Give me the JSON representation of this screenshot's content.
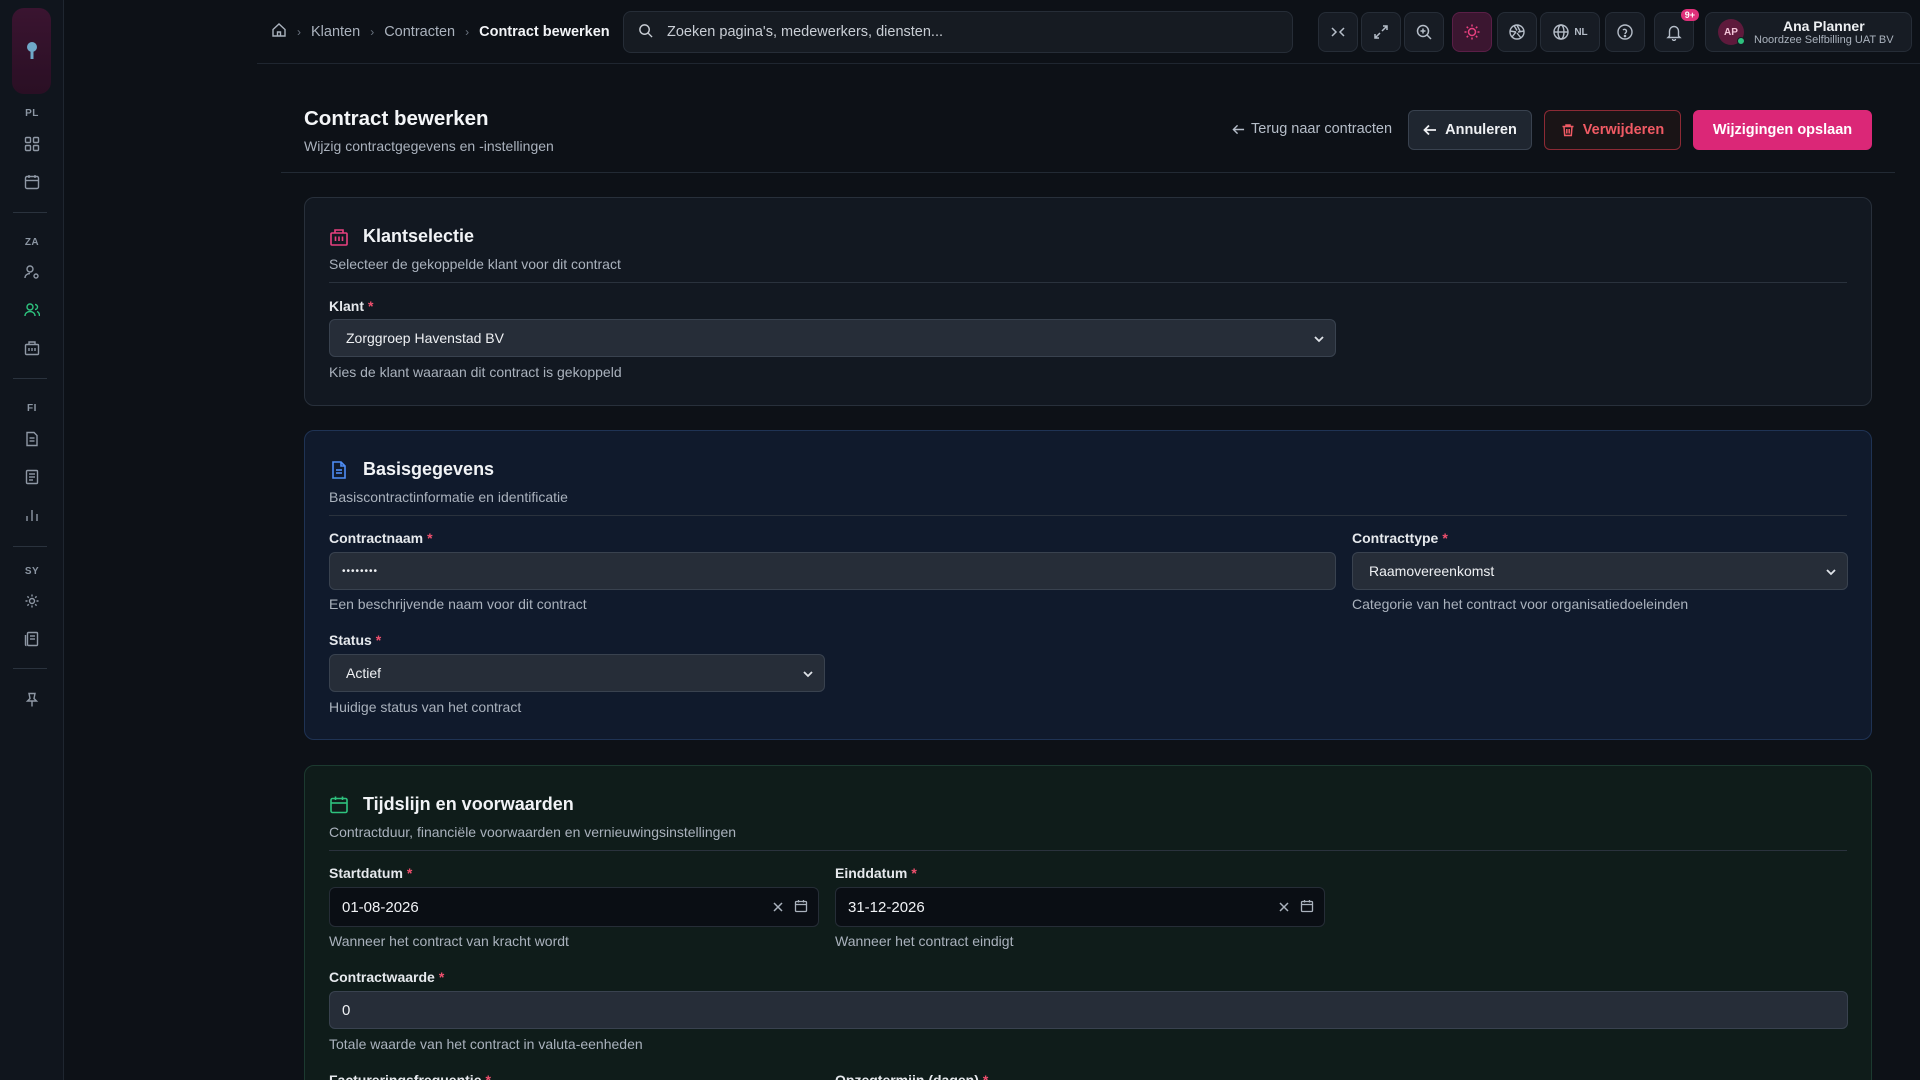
{
  "rail": {
    "sections": [
      "PL",
      "ZA",
      "FI",
      "SY"
    ]
  },
  "breadcrumb": {
    "items": [
      "Klanten",
      "Contracten"
    ],
    "current": "Contract bewerken"
  },
  "search": {
    "placeholder": "Zoeken pagina's, medewerkers, diensten..."
  },
  "topbar": {
    "language": "NL",
    "notification_badge": "9+"
  },
  "user": {
    "initials": "AP",
    "name": "Ana Planner",
    "org": "Noordzee Selfbilling UAT BV"
  },
  "page": {
    "title": "Contract bewerken",
    "subtitle": "Wijzig contractgegevens en -instellingen",
    "back_label": "Terug naar contracten",
    "cancel_label": "Annuleren",
    "delete_label": "Verwijderen",
    "save_label": "Wijzigingen opslaan"
  },
  "client_card": {
    "title": "Klantselectie",
    "subtitle": "Selecteer de gekoppelde klant voor dit contract",
    "client_label": "Klant",
    "client_value": "Zorggroep Havenstad BV",
    "client_hint": "Kies de klant waaraan dit contract is gekoppeld"
  },
  "basic_card": {
    "title": "Basisgegevens",
    "subtitle": "Basiscontractinformatie en identificatie",
    "name_label": "Contractnaam",
    "name_value": "••••••••",
    "name_hint": "Een beschrijvende naam voor dit contract",
    "type_label": "Contracttype",
    "type_value": "Raamovereenkomst",
    "type_hint": "Categorie van het contract voor organisatiedoeleinden",
    "status_label": "Status",
    "status_value": "Actief",
    "status_hint": "Huidige status van het contract"
  },
  "timeline_card": {
    "title": "Tijdslijn en voorwaarden",
    "subtitle": "Contractduur, financiële voorwaarden en vernieuwingsinstellingen",
    "start_label": "Startdatum",
    "start_value": "01-08-2026",
    "start_hint": "Wanneer het contract van kracht wordt",
    "end_label": "Einddatum",
    "end_value": "31-12-2026",
    "end_hint": "Wanneer het contract eindigt",
    "value_label": "Contractwaarde",
    "value_value": "0",
    "value_hint": "Totale waarde van het contract in valuta-eenheden",
    "frequency_label": "Factureringsfrequentie",
    "notice_label": "Opzegtermijn (dagen)"
  },
  "colors": {
    "accent": "#db2777",
    "danger": "#f05a64",
    "success": "#2ec27e",
    "info": "#4f8ef7"
  }
}
